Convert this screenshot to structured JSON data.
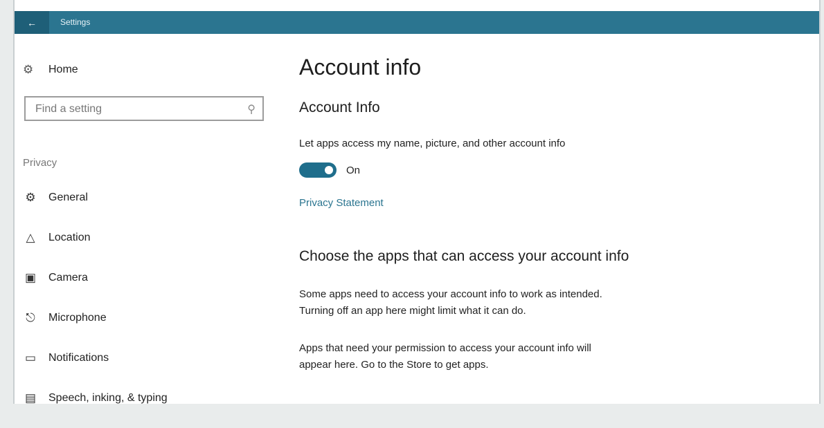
{
  "window": {
    "title": "Settings",
    "back_icon": "arrow-left-icon"
  },
  "sidebar": {
    "home": {
      "label": "Home",
      "icon": "gear-icon"
    },
    "search": {
      "placeholder": "Find a setting",
      "icon": "search-icon"
    },
    "section_label": "Privacy",
    "items": [
      {
        "label": "General",
        "icon": "lock-icon"
      },
      {
        "label": "Location",
        "icon": "location-icon"
      },
      {
        "label": "Camera",
        "icon": "camera-icon"
      },
      {
        "label": "Microphone",
        "icon": "microphone-icon"
      },
      {
        "label": "Notifications",
        "icon": "notifications-icon"
      },
      {
        "label": "Speech, inking, & typing",
        "icon": "speech-icon"
      }
    ]
  },
  "main": {
    "page_title": "Account info",
    "section_title": "Account Info",
    "toggle": {
      "description": "Let apps access my name, picture, and other account info",
      "state": "On",
      "enabled": true
    },
    "privacy_link": "Privacy Statement",
    "choose_title": "Choose the apps that can access your account info",
    "paragraph1_line1": "Some apps need to access your account info to work as intended.",
    "paragraph1_line2": "Turning off an app here might limit what it can do.",
    "paragraph2_line1": "Apps that need your permission to access your account info will",
    "paragraph2_line2": "appear here. Go to the Store to get apps."
  },
  "colors": {
    "accent": "#2b7590",
    "titlebar": "#2b7590",
    "back_button": "#1e5f78"
  }
}
